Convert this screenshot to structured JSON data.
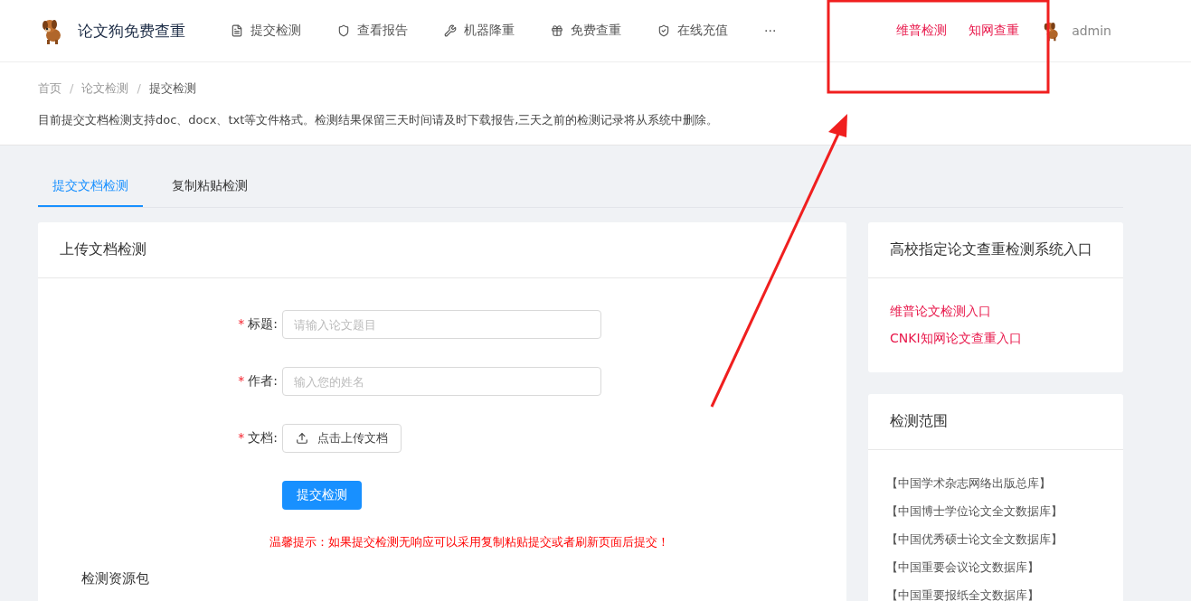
{
  "header": {
    "brand": "论文狗免费查重",
    "nav": [
      "提交检测",
      "查看报告",
      "机器降重",
      "免费查重",
      "在线充值",
      "···"
    ],
    "links": [
      "维普检测",
      "知网查重"
    ],
    "user": "admin"
  },
  "breadcrumb": {
    "separator": "/",
    "items": [
      "首页",
      "论文检测",
      "提交检测"
    ]
  },
  "notice": "目前提交文档检测支持doc、docx、txt等文件格式。检测结果保留三天时间请及时下载报告,三天之前的检测记录将从系统中删除。",
  "tabs": [
    {
      "label": "提交文档检测",
      "selected": true
    },
    {
      "label": "复制粘贴检测",
      "selected": false
    }
  ],
  "upload_card": {
    "title": "上传文档检测",
    "fields": [
      {
        "kind": "input",
        "required_mark": "*",
        "label": "标题:",
        "placeholder": "请输入论文题目"
      },
      {
        "kind": "input",
        "required_mark": "*",
        "label": "作者:",
        "placeholder": "输入您的姓名"
      },
      {
        "kind": "upload",
        "required_mark": "*",
        "label": "文档:",
        "button": "点击上传文档"
      }
    ],
    "submit": "提交检测",
    "tip": "温馨提示：如果提交检测无响应可以采用复制粘贴提交或者刷新页面后提交！",
    "section": "检测资源包"
  },
  "entry_card": {
    "title": "高校指定论文查重检测系统入口",
    "links": [
      "维普论文检测入口",
      "CNKI知网论文查重入口"
    ]
  },
  "scope_card": {
    "title": "检测范围",
    "items": [
      "【中国学术杂志网络出版总库】",
      "【中国博士学位论文全文数据库】",
      "【中国优秀硕士论文全文数据库】",
      "【中国重要会议论文数据库】",
      "【中国重要报纸全文数据库】"
    ]
  }
}
